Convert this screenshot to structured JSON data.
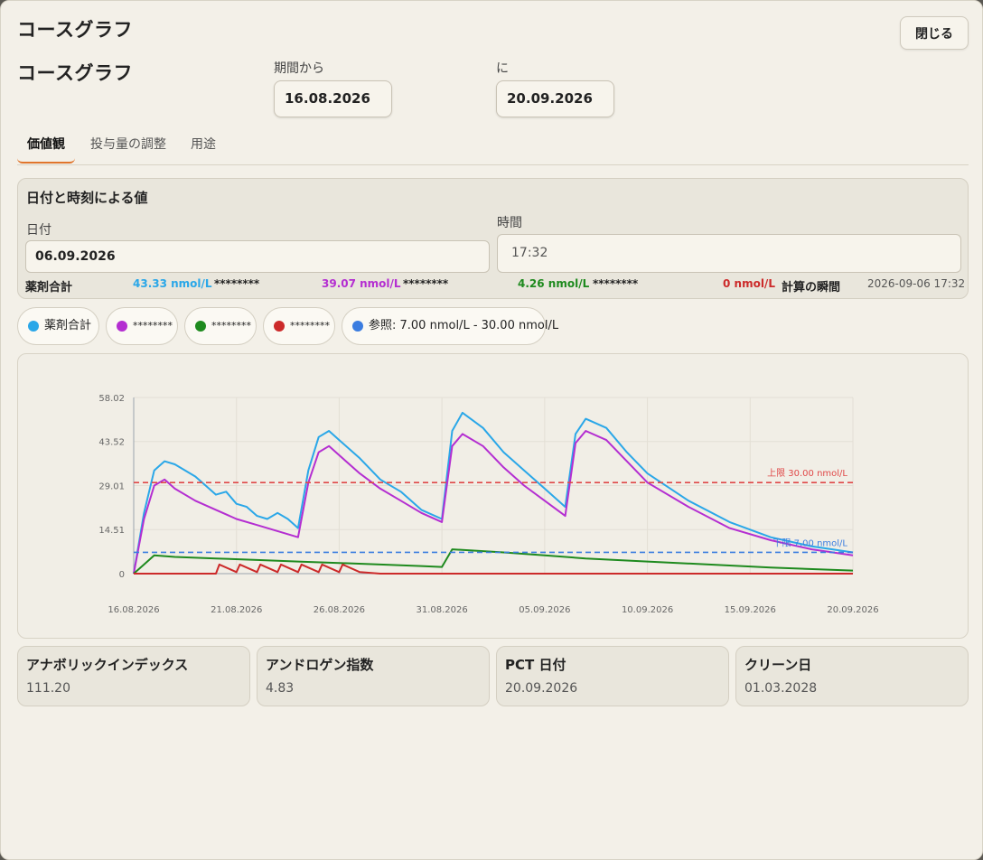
{
  "window": {
    "title": "コースグラフ",
    "close_label": "閉じる"
  },
  "header": {
    "section_title": "コースグラフ",
    "from_label": "期間から",
    "from_value": "16.08.2026",
    "to_label": "に",
    "to_value": "20.09.2026"
  },
  "tabs": [
    {
      "label": "価値観",
      "active": true
    },
    {
      "label": "投与量の調整",
      "active": false
    },
    {
      "label": "用途",
      "active": false
    }
  ],
  "value_panel": {
    "title": "日付と時刻による値",
    "date_label": "日付",
    "date_value": "06.09.2026",
    "time_label": "時間",
    "time_value": "17:32",
    "row": {
      "total_label": "薬剤合計",
      "total_value": "43.33 nmol/L",
      "s1_value": "39.07 nmol/L",
      "s1_name": "********",
      "s2_value": "4.26 nmol/L",
      "s2_name": "********",
      "s3_name": "********",
      "s3_value": "0 nmol/L",
      "instant_label": "計算の瞬間",
      "instant_value": "2026-09-06 17:32"
    },
    "row_colors": {
      "total": "#2aa7e8",
      "s1": "#b42ed1",
      "s2": "#1e8a1e",
      "s3": "#cc2a2a"
    }
  },
  "legend": [
    {
      "label": "薬剤合計",
      "color": "#2aa7e8"
    },
    {
      "label": "********",
      "color": "#b42ed1"
    },
    {
      "label": "********",
      "color": "#1e8a1e"
    },
    {
      "label": "********",
      "color": "#cc2a2a"
    },
    {
      "label": "参照: 7.00 nmol/L - 30.00 nmol/L",
      "color": "#3b7de0"
    }
  ],
  "chart_data": {
    "type": "line",
    "x_ticks": [
      "16.08.2026",
      "21.08.2026",
      "26.08.2026",
      "31.08.2026",
      "05.09.2026",
      "10.09.2026",
      "15.09.2026",
      "20.09.2026"
    ],
    "y_ticks": [
      "0",
      "14.51",
      "29.01",
      "43.52",
      "58.02"
    ],
    "xlim": [
      "16.08.2026",
      "20.09.2026"
    ],
    "ylim": [
      0,
      58.02
    ],
    "grid": true,
    "reference_lines": [
      {
        "label": "上限 30.00 nmol/L",
        "value": 30.0,
        "color": "#e04848"
      },
      {
        "label": "下限 7.00 nmol/L",
        "value": 7.0,
        "color": "#3b7de0"
      }
    ],
    "series": [
      {
        "name": "薬剤合計",
        "color": "#2aa7e8",
        "x": [
          "16.08.2026",
          "16.08.2026 12:00",
          "17.08.2026",
          "17.08.2026 12:00",
          "18.08.2026",
          "19.08.2026",
          "19.08.2026 12:00",
          "20.08.2026",
          "20.08.2026 12:00",
          "21.08.2026",
          "21.08.2026 12:00",
          "22.08.2026",
          "22.08.2026 12:00",
          "23.08.2026",
          "23.08.2026 12:00",
          "23.08.2026 20:00",
          "24.08.2026",
          "24.08.2026 12:00",
          "25.08.2026",
          "25.08.2026 12:00",
          "26.08.2026",
          "27.08.2026",
          "28.08.2026",
          "29.08.2026",
          "30.08.2026",
          "31.08.2026",
          "31.08.2026 12:00",
          "01.09.2026",
          "02.09.2026",
          "03.09.2026",
          "04.09.2026",
          "05.09.2026",
          "06.09.2026",
          "06.09.2026 12:00",
          "07.09.2026",
          "08.09.2026",
          "09.09.2026",
          "10.09.2026",
          "12.09.2026",
          "14.09.2026",
          "16.09.2026",
          "18.09.2026",
          "20.09.2026"
        ],
        "y": [
          0,
          20,
          34,
          37,
          36,
          32,
          29,
          26,
          27,
          23,
          22,
          19,
          18,
          20,
          18,
          16,
          15,
          34,
          45,
          47,
          44,
          38,
          31,
          27,
          21,
          18,
          47,
          53,
          48,
          40,
          34,
          28,
          22,
          46,
          51,
          48,
          40,
          33,
          24,
          17,
          12,
          9,
          7
        ]
      },
      {
        "name": "********",
        "color": "#b42ed1",
        "x": [
          "16.08.2026",
          "16.08.2026 12:00",
          "17.08.2026",
          "17.08.2026 12:00",
          "18.08.2026",
          "19.08.2026",
          "20.08.2026",
          "21.08.2026",
          "22.08.2026",
          "23.08.2026",
          "24.08.2026",
          "24.08.2026 12:00",
          "25.08.2026",
          "25.08.2026 12:00",
          "26.08.2026",
          "27.08.2026",
          "28.08.2026",
          "29.08.2026",
          "30.08.2026",
          "31.08.2026",
          "31.08.2026 12:00",
          "01.09.2026",
          "02.09.2026",
          "03.09.2026",
          "04.09.2026",
          "05.09.2026",
          "06.09.2026",
          "06.09.2026 12:00",
          "07.09.2026",
          "08.09.2026",
          "09.09.2026",
          "10.09.2026",
          "12.09.2026",
          "14.09.2026",
          "16.09.2026",
          "18.09.2026",
          "20.09.2026"
        ],
        "y": [
          0,
          18,
          29,
          31,
          28,
          24,
          21,
          18,
          16,
          14,
          12,
          30,
          40,
          42,
          39,
          33,
          28,
          24,
          20,
          17,
          42,
          46,
          42,
          35,
          29,
          24,
          19,
          43,
          47,
          44,
          37,
          30,
          22,
          15,
          11,
          8,
          6
        ]
      },
      {
        "name": "********",
        "color": "#1e8a1e",
        "x": [
          "16.08.2026",
          "16.08.2026 12:00",
          "17.08.2026",
          "18.08.2026",
          "20.08.2026",
          "22.08.2026",
          "24.08.2026",
          "26.08.2026",
          "28.08.2026",
          "30.08.2026",
          "31.08.2026",
          "31.08.2026 12:00",
          "01.09.2026",
          "03.09.2026",
          "05.09.2026",
          "07.09.2026",
          "10.09.2026",
          "13.09.2026",
          "16.09.2026",
          "20.09.2026"
        ],
        "y": [
          0,
          3,
          6,
          5.5,
          5,
          4.5,
          4,
          3.5,
          3,
          2.5,
          2.2,
          8,
          7.8,
          7,
          6,
          5,
          4,
          3,
          2,
          1
        ]
      },
      {
        "name": "********",
        "color": "#cc2a2a",
        "x": [
          "16.08.2026",
          "20.08.2026",
          "20.08.2026 04:00",
          "21.08.2026",
          "21.08.2026 04:00",
          "22.08.2026",
          "22.08.2026 04:00",
          "23.08.2026",
          "23.08.2026 04:00",
          "24.08.2026",
          "24.08.2026 04:00",
          "25.08.2026",
          "25.08.2026 04:00",
          "26.08.2026",
          "26.08.2026 04:00",
          "27.08.2026",
          "28.08.2026",
          "20.09.2026"
        ],
        "y": [
          0,
          0,
          3,
          0.5,
          3,
          0.5,
          3,
          0.5,
          3,
          0.5,
          3,
          0.5,
          3,
          0.5,
          3,
          0.5,
          0,
          0
        ]
      }
    ]
  },
  "stats": [
    {
      "title": "アナボリックインデックス",
      "value": "111.20"
    },
    {
      "title": "アンドロゲン指数",
      "value": "4.83"
    },
    {
      "title": "PCT 日付",
      "value": "20.09.2026"
    },
    {
      "title": "クリーン日",
      "value": "01.03.2028"
    }
  ]
}
